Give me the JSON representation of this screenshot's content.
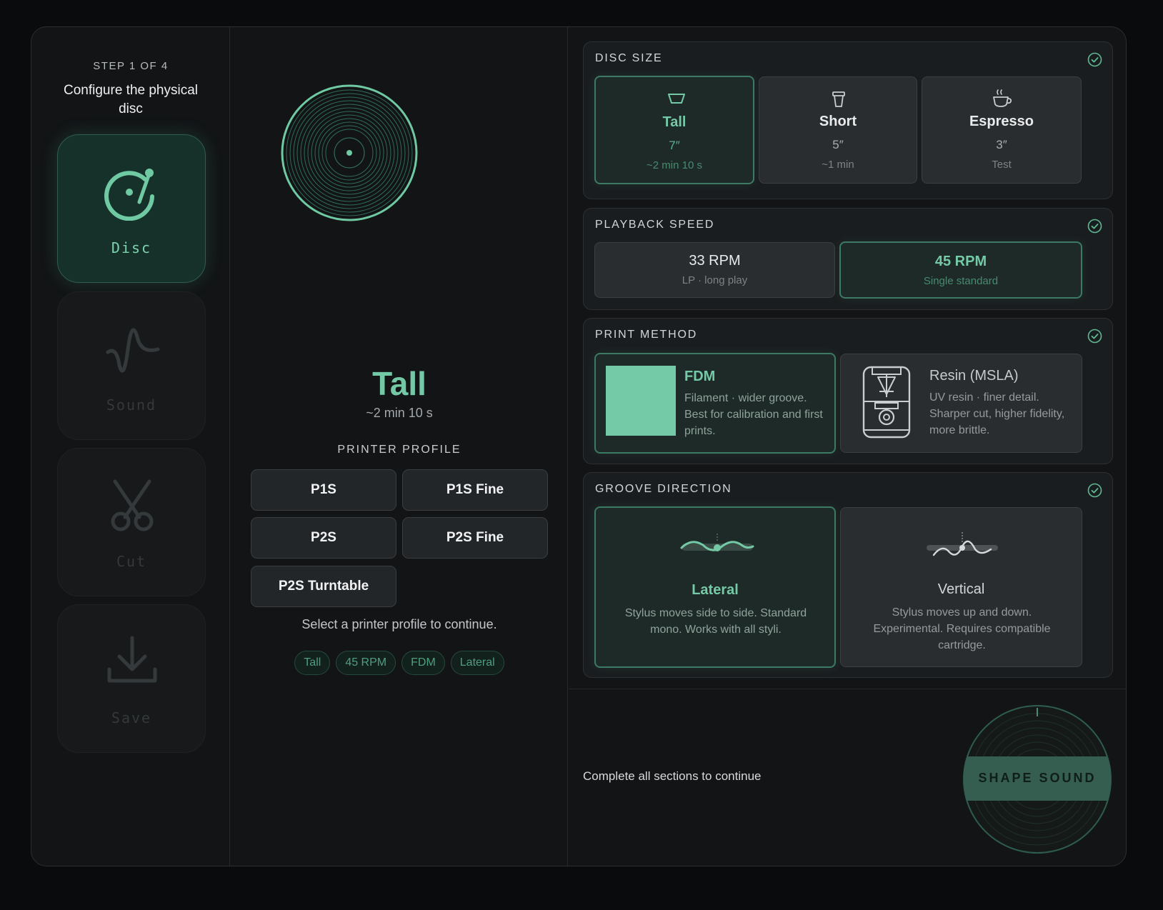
{
  "step": {
    "label": "STEP 1 OF 4",
    "description": "Configure the physical disc"
  },
  "rail": {
    "items": [
      {
        "label": "Disc",
        "icon": "turntable-icon",
        "active": true
      },
      {
        "label": "Sound",
        "icon": "waveform-icon",
        "active": false
      },
      {
        "label": "Cut",
        "icon": "scissors-icon",
        "active": false
      },
      {
        "label": "Save",
        "icon": "download-icon",
        "active": false
      }
    ]
  },
  "preview": {
    "title": "Tall",
    "subtitle": "~2 min 10 s"
  },
  "printer_profile": {
    "title": "PRINTER PROFILE",
    "options": [
      "P1S",
      "P1S Fine",
      "P2S",
      "P2S Fine",
      "P2S Turntable"
    ],
    "hint": "Select a printer profile to continue."
  },
  "summary_chips": [
    "Tall",
    "45 RPM",
    "FDM",
    "Lateral"
  ],
  "disc_size": {
    "title": "DISC SIZE",
    "options": [
      {
        "name": "Tall",
        "size": "7″",
        "note": "~2 min 10 s",
        "icon": "bowl-icon",
        "selected": true
      },
      {
        "name": "Short",
        "size": "5″",
        "note": "~1 min",
        "icon": "cup-icon",
        "selected": false
      },
      {
        "name": "Espresso",
        "size": "3″",
        "note": "Test",
        "icon": "coffee-cup-icon",
        "selected": false
      }
    ]
  },
  "playback_speed": {
    "title": "PLAYBACK SPEED",
    "options": [
      {
        "name": "33 RPM",
        "desc": "LP · long play",
        "selected": false
      },
      {
        "name": "45 RPM",
        "desc": "Single standard",
        "selected": true
      }
    ]
  },
  "print_method": {
    "title": "PRINT METHOD",
    "options": [
      {
        "name": "FDM",
        "desc": "Filament · wider groove. Best for calibration and first prints.",
        "selected": true
      },
      {
        "name": "Resin (MSLA)",
        "desc": "UV resin · finer detail. Sharper cut, higher fidelity, more brittle.",
        "icon": "resin-printer-icon",
        "selected": false
      }
    ]
  },
  "groove_direction": {
    "title": "GROOVE DIRECTION",
    "options": [
      {
        "name": "Lateral",
        "desc": "Stylus moves side to side. Standard mono. Works with all styli.",
        "icon": "lateral-groove-icon",
        "selected": true
      },
      {
        "name": "Vertical",
        "desc": "Stylus moves up and down. Experimental. Requires compatible cartridge.",
        "icon": "vertical-groove-icon",
        "selected": false
      }
    ]
  },
  "footer": {
    "message": "Complete all sections to continue",
    "cta": "SHAPE SOUND"
  },
  "colors": {
    "accent": "#74c9a6",
    "background": "#121416",
    "panel": "#1a1d1f"
  }
}
